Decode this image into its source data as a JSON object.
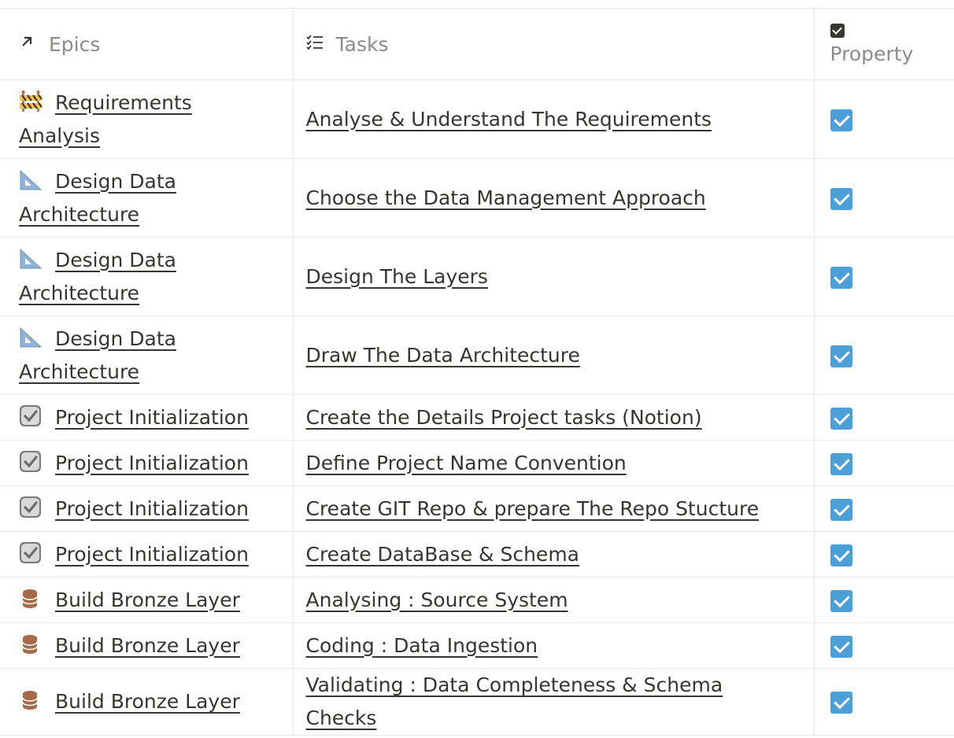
{
  "header": {
    "epics_label": "Epics",
    "tasks_label": "Tasks",
    "property_label": "Property",
    "epics_icon": "arrow-up-right-icon",
    "tasks_icon": "checklist-icon",
    "property_icon": "checkbox-icon"
  },
  "rows": [
    {
      "epic": "Requirements Analysis",
      "epic_icon": "construction-icon",
      "task": "Analyse & Understand The Requirements",
      "checked": true
    },
    {
      "epic": "Design Data Architecture",
      "epic_icon": "triangle-ruler-icon",
      "task": "Choose the Data Management Approach",
      "checked": true
    },
    {
      "epic": "Design Data Architecture",
      "epic_icon": "triangle-ruler-icon",
      "task": "Design The Layers",
      "checked": true
    },
    {
      "epic": "Design Data Architecture",
      "epic_icon": "triangle-ruler-icon",
      "task": "Draw The Data Architecture",
      "checked": true
    },
    {
      "epic": "Project Initialization",
      "epic_icon": "check-box-icon",
      "task": "Create the Details Project tasks (Notion)",
      "checked": true
    },
    {
      "epic": "Project Initialization",
      "epic_icon": "check-box-icon",
      "task": "Define Project Name Convention",
      "checked": true
    },
    {
      "epic": "Project Initialization",
      "epic_icon": "check-box-icon",
      "task": "Create GIT Repo & prepare The Repo Stucture",
      "checked": true
    },
    {
      "epic": "Project Initialization",
      "epic_icon": "check-box-icon",
      "task": "Create DataBase & Schema",
      "checked": true
    },
    {
      "epic": "Build Bronze Layer",
      "epic_icon": "database-icon",
      "task": "Analysing : Source System",
      "checked": true
    },
    {
      "epic": "Build Bronze Layer",
      "epic_icon": "database-icon",
      "task": "Coding : Data Ingestion",
      "checked": true
    },
    {
      "epic": "Build Bronze Layer",
      "epic_icon": "database-icon",
      "task": "Validating : Data Completeness & Schema Checks",
      "checked": true
    }
  ],
  "colors": {
    "checkbox": "#4d9fd8",
    "bronze": "#a86b4a"
  }
}
